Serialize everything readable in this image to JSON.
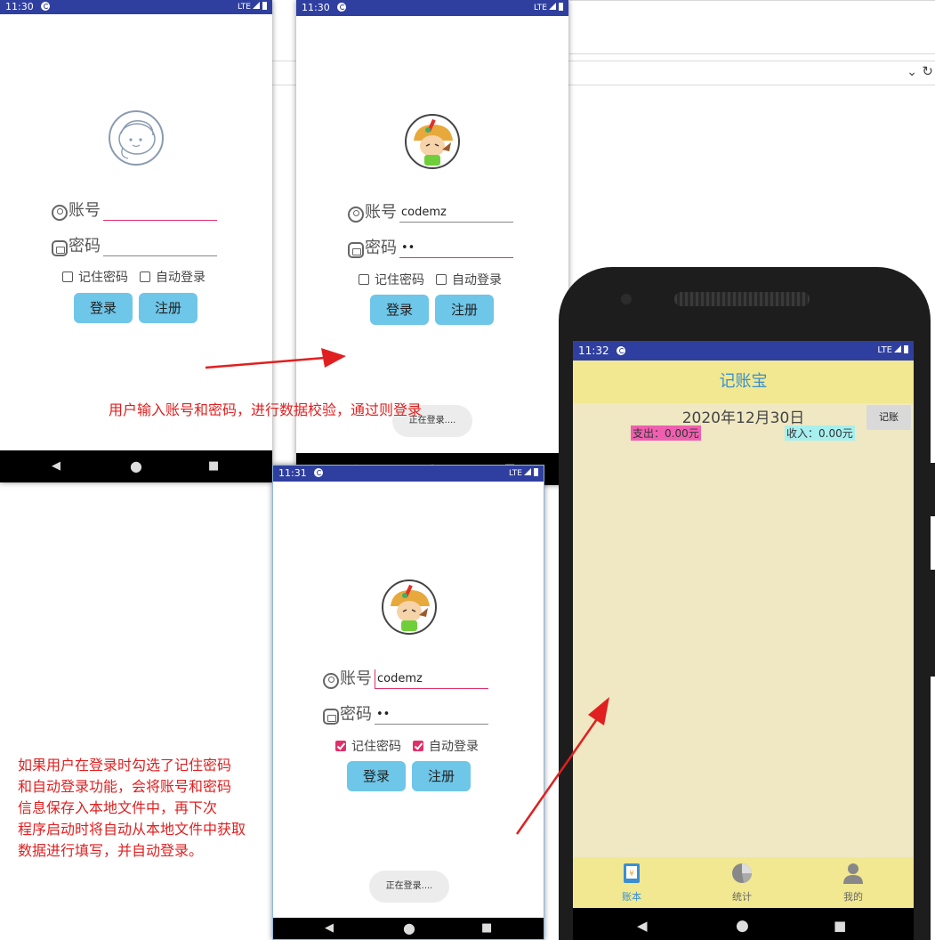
{
  "screen1": {
    "time": "11:30",
    "network": "LTE",
    "account_label": "账号",
    "account_value": "",
    "password_label": "密码",
    "password_value": "",
    "remember_label": "记住密码",
    "auto_login_label": "自动登录",
    "login_button": "登录",
    "register_button": "注册"
  },
  "screen2": {
    "time": "11:30",
    "network": "LTE",
    "account_label": "账号",
    "account_value": "codemz",
    "password_label": "密码",
    "password_value": "••",
    "remember_label": "记住密码",
    "auto_login_label": "自动登录",
    "login_button": "登录",
    "register_button": "注册",
    "toast": "正在登录...."
  },
  "screen3": {
    "time": "11:31",
    "network": "LTE",
    "account_label": "账号",
    "account_value": "codemz",
    "password_label": "密码",
    "password_value": "••",
    "remember_label": "记住密码",
    "remember_checked": true,
    "auto_login_label": "自动登录",
    "auto_login_checked": true,
    "login_button": "登录",
    "register_button": "注册",
    "toast": "正在登录...."
  },
  "device": {
    "time": "11:32",
    "network": "LTE",
    "app_title": "记账宝",
    "date": "2020年12月30日",
    "record_button": "记账",
    "expense": "支出：0.00元",
    "income": "收入：0.00元",
    "tabs": [
      {
        "label": "账本",
        "icon": "ledger-icon",
        "active": true
      },
      {
        "label": "统计",
        "icon": "pie-chart-icon",
        "active": false
      },
      {
        "label": "我的",
        "icon": "person-icon",
        "active": false
      }
    ]
  },
  "annotations": {
    "top": "用户输入账号和密码，进行数据校验，通过则登录",
    "bottom": [
      "如果用户在登录时勾选了记住密码",
      "和自动登录功能，会将账号和密码",
      "信息保存入本地文件中，再下次",
      "程序启动时将自动从本地文件中获取",
      "数据进行填写，并自动登录。"
    ]
  },
  "colors": {
    "status_bar": "#2f3fa0",
    "button": "#6ec6e8",
    "accent": "#e0306a",
    "app_bar": "#f1e891",
    "annotation": "#e02020"
  }
}
